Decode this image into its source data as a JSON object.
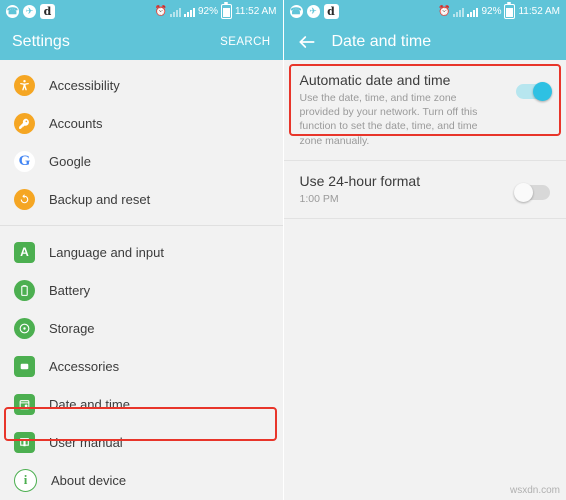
{
  "left": {
    "statusbar": {
      "icons": [
        "whatsapp-icon",
        "telegram-icon",
        "dapp-icon"
      ],
      "alarm": "⏰",
      "signal1": "signal-bars-icon",
      "signal2": "signal-bars-icon",
      "battery_text": "92%",
      "time": "11:52 AM"
    },
    "appbar": {
      "title": "Settings",
      "action": "SEARCH"
    },
    "items": [
      {
        "label": "Accessibility",
        "icon": "accessibility-icon",
        "color": "#f5a623",
        "glyph": "accessibility"
      },
      {
        "label": "Accounts",
        "icon": "key-icon",
        "color": "#f5a623",
        "glyph": "key"
      },
      {
        "label": "Google",
        "icon": "google-icon",
        "color": "#4285f4",
        "glyph": "G"
      },
      {
        "label": "Backup and reset",
        "icon": "backup-icon",
        "color": "#f5a623",
        "glyph": "backup"
      },
      {
        "label": "Language and input",
        "icon": "language-icon",
        "color": "#4caf50",
        "glyph": "A"
      },
      {
        "label": "Battery",
        "icon": "battery-icon",
        "color": "#4caf50",
        "glyph": "battery"
      },
      {
        "label": "Storage",
        "icon": "storage-icon",
        "color": "#4caf50",
        "glyph": "storage"
      },
      {
        "label": "Accessories",
        "icon": "accessories-icon",
        "color": "#4caf50",
        "glyph": "accessories"
      },
      {
        "label": "Date and time",
        "icon": "date-time-icon",
        "color": "#4caf50",
        "glyph": "calendar"
      },
      {
        "label": "User manual",
        "icon": "user-manual-icon",
        "color": "#4caf50",
        "glyph": "book"
      },
      {
        "label": "About device",
        "icon": "about-device-icon",
        "color": "#4caf50",
        "glyph": "i"
      }
    ],
    "highlight": {
      "target": "Date and time",
      "color": "#e8352a"
    }
  },
  "right": {
    "statusbar": {
      "battery_text": "92%",
      "time": "11:52 AM"
    },
    "appbar": {
      "title": "Date and time",
      "back": "back-arrow-icon"
    },
    "prefs": [
      {
        "title": "Automatic date and time",
        "subtitle": "Use the date, time, and time zone provided by your network. Turn off this function to set the date, time, and time zone manually.",
        "toggle": "on",
        "highlighted": true
      },
      {
        "title": "Use 24-hour format",
        "subtitle": "1:00 PM",
        "toggle": "off",
        "highlighted": false
      }
    ],
    "watermark": "wsxdn.com"
  },
  "colors": {
    "accent": "#5fc4d8",
    "toggle_on": "#2ec1e3",
    "highlight": "#e8352a",
    "orange": "#f5a623",
    "green": "#4caf50",
    "blue": "#4285f4"
  }
}
